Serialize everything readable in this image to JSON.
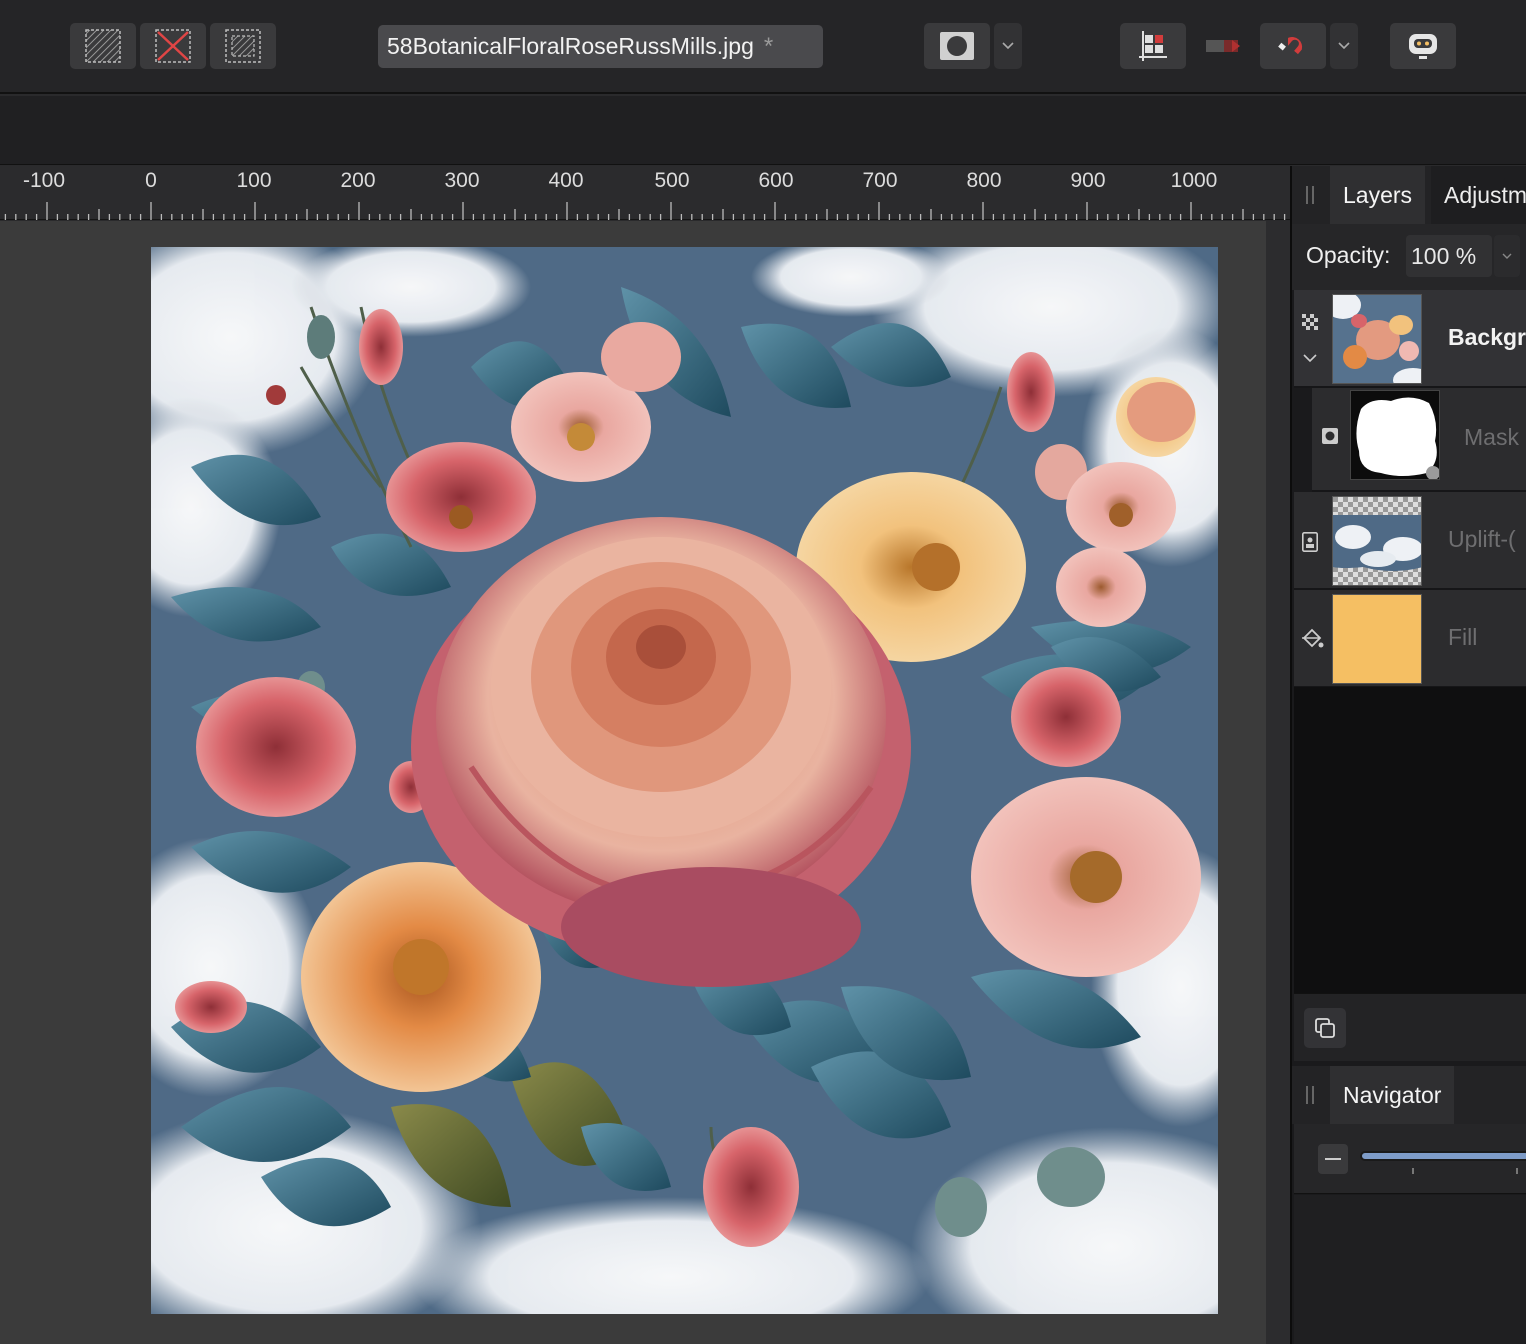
{
  "toolbar": {
    "selection_buttons": [
      {
        "name": "select-all"
      },
      {
        "name": "deselect"
      },
      {
        "name": "invert-selection"
      }
    ],
    "document_title": "58BotanicalFloralRoseRussMills.jpg",
    "modified_marker": "*",
    "icons": {
      "quick_mask": "quick-mask-icon",
      "snapping": "snapping-icon",
      "assistant": "assistant-icon"
    }
  },
  "ruler": {
    "labels": [
      "-100",
      "0",
      "100",
      "200",
      "300",
      "400",
      "500",
      "600",
      "700",
      "800",
      "900",
      "1000"
    ]
  },
  "panels": {
    "layers_tab": "Layers",
    "adjustments_tab": "Adjustm",
    "opacity_label": "Opacity:",
    "opacity_value": "100 %",
    "layers": [
      {
        "name": "Backgro",
        "type": "pixel",
        "selected": true
      },
      {
        "name": "Mask",
        "type": "mask",
        "selected": false
      },
      {
        "name": "Uplift-(",
        "type": "image",
        "selected": false
      },
      {
        "name": "Fill",
        "type": "fill",
        "selected": false,
        "color": "#f5bf63"
      }
    ],
    "navigator_tab": "Navigator"
  },
  "colors": {
    "accent": "#7e9cc8",
    "snapping_red": "#d23c3c",
    "fill_layer": "#f5bf63",
    "sky": "#4f6a86"
  }
}
